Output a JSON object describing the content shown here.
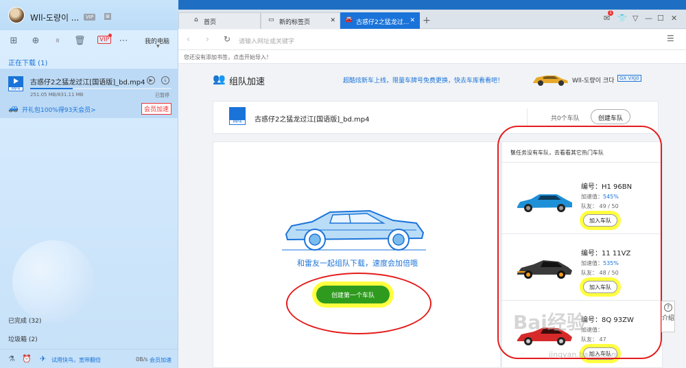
{
  "sidebar": {
    "username": "Wll-도량이 ...",
    "vip_badge": "VIP",
    "vip_button": "VIP",
    "my_computer": "我的电脑",
    "downloading_tab": "正在下载 (1)",
    "task": {
      "name": "古惑仔2之猛龙过江[国语版]_bd.mp4",
      "size": "251.05 MB/831.11 MB",
      "status": "已暂停",
      "progress": 0.3,
      "promo": "开礼包100%得93天会员>",
      "accel_button": "会员加速",
      "file_type": "MP4"
    },
    "completed": "已完成 (32)",
    "trash": "垃圾箱 (2)",
    "try_fast": "试用快鸟，宽带翻倍",
    "speed": "0B/s",
    "speed_accel": "会员加速"
  },
  "browser": {
    "tabs": [
      {
        "label": "首页"
      },
      {
        "label": "新的标签页"
      },
      {
        "label": "古惑仔2之猛龙过..."
      }
    ],
    "notification_count": "1",
    "address_placeholder": "请输入网址或关键字",
    "bookmark_hint": "您还没有添加书签，点击开始导入！"
  },
  "page": {
    "title": "组队加速",
    "promo": "超酷炫新车上线，限量车牌号免费更换，快去车库看看吧！",
    "user": "Wll-도량이 크다",
    "plate": "GX VXJ0",
    "file_name": "古惑仔2之猛龙过江[国语版]_bd.mp4",
    "file_type": "MP4",
    "team_count": "共0个车队",
    "create_team": "创建车队",
    "hint": "和雷友一起组队下载，速度会加倍哦",
    "create_first": "创建第一个车队",
    "side_header": "该任务没有车队，去看看其它热门车队",
    "teams": [
      {
        "id": "编号：H1 96BN",
        "speed_label": "加速值：",
        "speed": "545%",
        "members": "队友： 49 / 50",
        "join": "加入车队",
        "color": "#1e90d8"
      },
      {
        "id": "编号：11 11VZ",
        "speed_label": "加速值：",
        "speed": "535%",
        "members": "队友： 48 / 50",
        "join": "加入车队",
        "color": "#3a3a3a"
      },
      {
        "id": "编号：8Q 93ZW",
        "speed_label": "加速值：",
        "speed": "",
        "members": "队友： 47",
        "join": "加入车队",
        "color": "#d62a2a"
      }
    ],
    "help": "介绍",
    "watermark": "Bai经验",
    "watermark_url": "jingyan.baidu.com"
  }
}
